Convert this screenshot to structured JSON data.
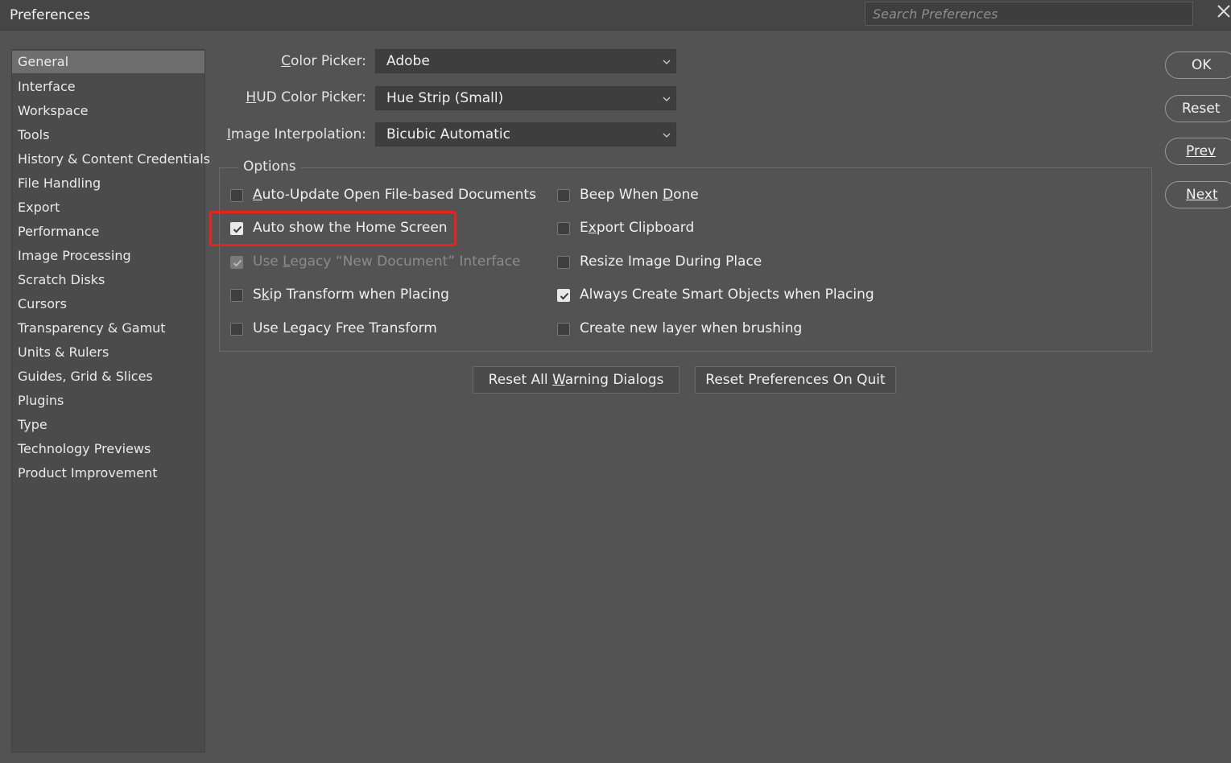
{
  "window": {
    "title": "Preferences",
    "search_placeholder": "Search Preferences"
  },
  "sidebar": {
    "items": [
      {
        "label": "General",
        "selected": true
      },
      {
        "label": "Interface"
      },
      {
        "label": "Workspace"
      },
      {
        "label": "Tools"
      },
      {
        "label": "History & Content Credentials"
      },
      {
        "label": "File Handling"
      },
      {
        "label": "Export"
      },
      {
        "label": "Performance"
      },
      {
        "label": "Image Processing"
      },
      {
        "label": "Scratch Disks"
      },
      {
        "label": "Cursors"
      },
      {
        "label": "Transparency & Gamut"
      },
      {
        "label": "Units & Rulers"
      },
      {
        "label": "Guides, Grid & Slices"
      },
      {
        "label": "Plugins"
      },
      {
        "label": "Type"
      },
      {
        "label": "Technology Previews"
      },
      {
        "label": "Product Improvement"
      }
    ]
  },
  "fields": {
    "color_picker": {
      "label_ul": "C",
      "label_rest": "olor Picker:",
      "value": "Adobe"
    },
    "hud_color_picker": {
      "label_ul": "H",
      "label_rest": "UD Color Picker:",
      "value": "Hue Strip (Small)"
    },
    "image_interpolation": {
      "label_ul": "I",
      "label_rest": "mage Interpolation:",
      "value": "Bicubic Automatic"
    }
  },
  "options": {
    "legend": "Options",
    "left": [
      {
        "pre": "",
        "ul": "A",
        "post": "uto-Update Open File-based Documents",
        "checked": false,
        "disabled": false
      },
      {
        "pre": "Auto show the Home Screen",
        "ul": "",
        "post": "",
        "checked": true,
        "disabled": false
      },
      {
        "pre": "Use ",
        "ul": "L",
        "post": "egacy “New Document” Interface",
        "checked": true,
        "disabled": true
      },
      {
        "pre": "S",
        "ul": "k",
        "post": "ip Transform when Placing",
        "checked": false,
        "disabled": false
      },
      {
        "pre": "Use Legacy Free Transform",
        "ul": "",
        "post": "",
        "checked": false,
        "disabled": false
      }
    ],
    "right": [
      {
        "pre": "Beep When ",
        "ul": "D",
        "post": "one",
        "checked": false,
        "disabled": false
      },
      {
        "pre": "E",
        "ul": "x",
        "post": "port Clipboard",
        "checked": false,
        "disabled": false
      },
      {
        "pre": "Resize Image During Place",
        "ul": "",
        "post": "",
        "checked": false,
        "disabled": false
      },
      {
        "pre": "Always Create Smart Objects when Placing",
        "ul": "",
        "post": "",
        "checked": true,
        "disabled": false
      },
      {
        "pre": "Create new layer when brushing",
        "ul": "",
        "post": "",
        "checked": false,
        "disabled": false
      }
    ]
  },
  "buttons": {
    "reset_warnings": {
      "pre": "Reset All ",
      "ul": "W",
      "post": "arning Dialogs"
    },
    "reset_on_quit": "Reset Preferences On Quit",
    "ok": "OK",
    "reset": "Reset",
    "prev": "Prev",
    "next": "Next"
  },
  "colors": {
    "background": "#535353",
    "highlight": "#e8231b"
  },
  "icons": {
    "close": "close-icon",
    "chevron": "chevron-down-icon",
    "check": "checkmark-icon"
  }
}
